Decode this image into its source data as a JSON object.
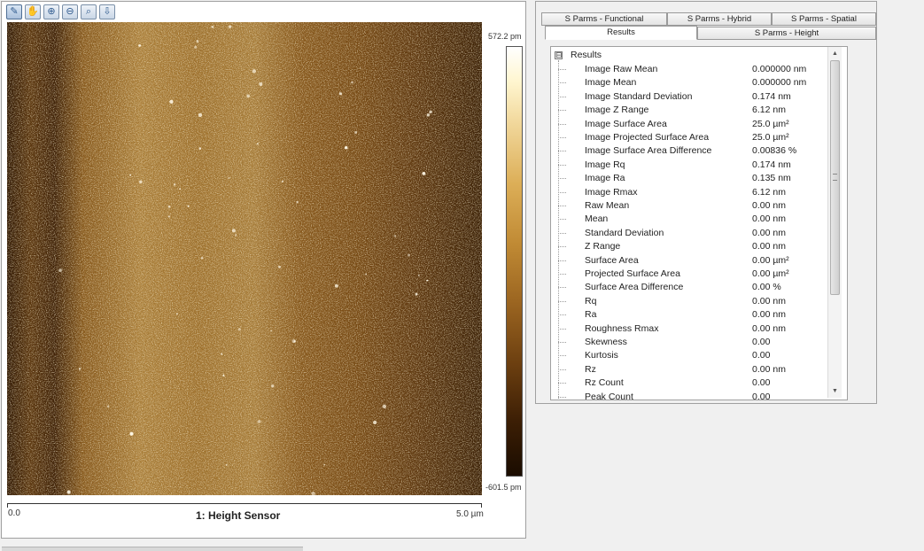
{
  "toolbar": {
    "tools": [
      {
        "name": "pencil-tool-icon",
        "glyph": "✎"
      },
      {
        "name": "hand-tool-icon",
        "glyph": "✋"
      },
      {
        "name": "zoom-in-icon",
        "glyph": "⊕"
      },
      {
        "name": "zoom-out-icon",
        "glyph": "⊖"
      },
      {
        "name": "zoom-reset-icon",
        "glyph": "⌕"
      },
      {
        "name": "export-icon",
        "glyph": "⇩"
      }
    ]
  },
  "image": {
    "scale_max": "572.2 pm",
    "scale_min": "-601.5 pm",
    "axis_start": "0.0",
    "axis_end": "5.0 µm",
    "channel_title": "1: Height Sensor"
  },
  "tabs": {
    "row1": [
      "S Parms - Functional",
      "S Parms - Hybrid",
      "S Parms - Spatial"
    ],
    "row2": [
      "Results",
      "S Parms - Height"
    ],
    "active": "Results"
  },
  "results": {
    "root_label": "Results",
    "expander": "⊟",
    "rows": [
      {
        "label": "Image Raw Mean",
        "value": "0.000000 nm"
      },
      {
        "label": "Image Mean",
        "value": "0.000000 nm"
      },
      {
        "label": "Image Standard Deviation",
        "value": "0.174 nm"
      },
      {
        "label": "Image Z Range",
        "value": "6.12 nm"
      },
      {
        "label": "Image Surface Area",
        "value": "25.0 µm²"
      },
      {
        "label": "Image Projected Surface Area",
        "value": "25.0 µm²"
      },
      {
        "label": "Image Surface Area Difference",
        "value": "0.00836 %"
      },
      {
        "label": "Image Rq",
        "value": "0.174 nm"
      },
      {
        "label": "Image Ra",
        "value": "0.135 nm"
      },
      {
        "label": "Image Rmax",
        "value": "6.12 nm"
      },
      {
        "label": "Raw Mean",
        "value": "0.00 nm"
      },
      {
        "label": "Mean",
        "value": "0.00 nm"
      },
      {
        "label": "Standard Deviation",
        "value": "0.00 nm"
      },
      {
        "label": "Z Range",
        "value": "0.00 nm"
      },
      {
        "label": "Surface Area",
        "value": "0.00 µm²"
      },
      {
        "label": "Projected Surface Area",
        "value": "0.00 µm²"
      },
      {
        "label": "Surface Area Difference",
        "value": "0.00 %"
      },
      {
        "label": "Rq",
        "value": "0.00 nm"
      },
      {
        "label": "Ra",
        "value": "0.00 nm"
      },
      {
        "label": "Roughness Rmax",
        "value": "0.00 nm"
      },
      {
        "label": "Skewness",
        "value": "0.00"
      },
      {
        "label": "Kurtosis",
        "value": "0.00"
      },
      {
        "label": "Rz",
        "value": "0.00 nm"
      },
      {
        "label": "Rz Count",
        "value": "0.00"
      },
      {
        "label": "Peak Count",
        "value": "0.00"
      }
    ]
  },
  "scrollbar": {
    "up": "▲",
    "down": "▼"
  }
}
